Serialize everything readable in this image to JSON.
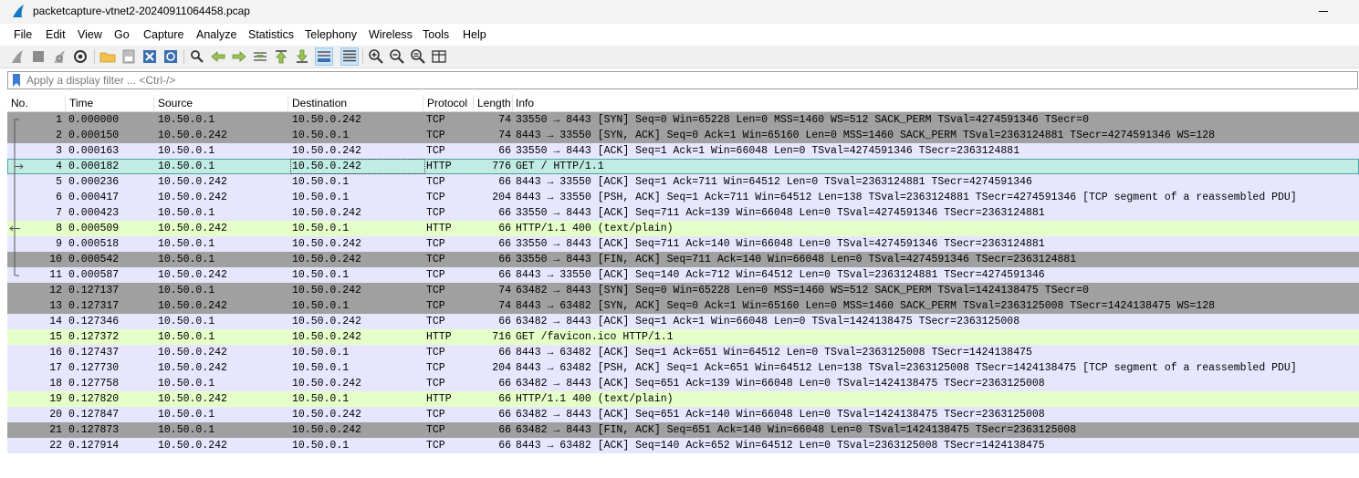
{
  "window": {
    "title": "packetcapture-vtnet2-20240911064458.pcap"
  },
  "menu": [
    "File",
    "Edit",
    "View",
    "Go",
    "Capture",
    "Analyze",
    "Statistics",
    "Telephony",
    "Wireless",
    "Tools",
    "Help"
  ],
  "toolbar": {
    "icons": [
      "shark-fin-start-icon",
      "stop-square-icon",
      "shark-fin-restart-icon",
      "capture-options-gear-icon",
      "open-folder-icon",
      "save-file-icon",
      "close-file-icon",
      "reload-file-icon",
      "find-packet-icon",
      "go-back-icon",
      "go-forward-icon",
      "go-to-packet-icon",
      "go-first-icon",
      "go-last-icon",
      "autoscroll-icon",
      "colorize-icon",
      "zoom-in-icon",
      "zoom-out-icon",
      "zoom-normal-icon",
      "resize-columns-icon"
    ]
  },
  "filter": {
    "placeholder": "Apply a display filter ... <Ctrl-/>",
    "value": ""
  },
  "columns": [
    "No.",
    "Time",
    "Source",
    "Destination",
    "Protocol",
    "Length",
    "Info"
  ],
  "packets": [
    {
      "no": "1",
      "time": "0.000000",
      "src": "10.50.0.1",
      "dst": "10.50.0.242",
      "proto": "TCP",
      "len": "74",
      "info": "33550 → 8443 [SYN] Seq=0 Win=65228 Len=0 MSS=1460 WS=512 SACK_PERM TSval=4274591346 TSecr=0",
      "color": "syn"
    },
    {
      "no": "2",
      "time": "0.000150",
      "src": "10.50.0.242",
      "dst": "10.50.0.1",
      "proto": "TCP",
      "len": "74",
      "info": "8443 → 33550 [SYN, ACK] Seq=0 Ack=1 Win=65160 Len=0 MSS=1460 SACK_PERM TSval=2363124881 TSecr=4274591346 WS=128",
      "color": "syn"
    },
    {
      "no": "3",
      "time": "0.000163",
      "src": "10.50.0.1",
      "dst": "10.50.0.242",
      "proto": "TCP",
      "len": "66",
      "info": "33550 → 8443 [ACK] Seq=1 Ack=1 Win=66048 Len=0 TSval=4274591346 TSecr=2363124881",
      "color": "tcp"
    },
    {
      "no": "4",
      "time": "0.000182",
      "src": "10.50.0.1",
      "dst": "10.50.0.242",
      "proto": "HTTP",
      "len": "776",
      "info": "GET / HTTP/1.1",
      "color": "sel"
    },
    {
      "no": "5",
      "time": "0.000236",
      "src": "10.50.0.242",
      "dst": "10.50.0.1",
      "proto": "TCP",
      "len": "66",
      "info": "8443 → 33550 [ACK] Seq=1 Ack=711 Win=64512 Len=0 TSval=2363124881 TSecr=4274591346",
      "color": "tcp"
    },
    {
      "no": "6",
      "time": "0.000417",
      "src": "10.50.0.242",
      "dst": "10.50.0.1",
      "proto": "TCP",
      "len": "204",
      "info": "8443 → 33550 [PSH, ACK] Seq=1 Ack=711 Win=64512 Len=138 TSval=2363124881 TSecr=4274591346 [TCP segment of a reassembled PDU]",
      "color": "tcp"
    },
    {
      "no": "7",
      "time": "0.000423",
      "src": "10.50.0.1",
      "dst": "10.50.0.242",
      "proto": "TCP",
      "len": "66",
      "info": "33550 → 8443 [ACK] Seq=711 Ack=139 Win=66048 Len=0 TSval=4274591346 TSecr=2363124881",
      "color": "tcp"
    },
    {
      "no": "8",
      "time": "0.000509",
      "src": "10.50.0.242",
      "dst": "10.50.0.1",
      "proto": "HTTP",
      "len": "66",
      "info": "HTTP/1.1 400   (text/plain)",
      "color": "http"
    },
    {
      "no": "9",
      "time": "0.000518",
      "src": "10.50.0.1",
      "dst": "10.50.0.242",
      "proto": "TCP",
      "len": "66",
      "info": "33550 → 8443 [ACK] Seq=711 Ack=140 Win=66048 Len=0 TSval=4274591346 TSecr=2363124881",
      "color": "tcp"
    },
    {
      "no": "10",
      "time": "0.000542",
      "src": "10.50.0.1",
      "dst": "10.50.0.242",
      "proto": "TCP",
      "len": "66",
      "info": "33550 → 8443 [FIN, ACK] Seq=711 Ack=140 Win=66048 Len=0 TSval=4274591346 TSecr=2363124881",
      "color": "syn"
    },
    {
      "no": "11",
      "time": "0.000587",
      "src": "10.50.0.242",
      "dst": "10.50.0.1",
      "proto": "TCP",
      "len": "66",
      "info": "8443 → 33550 [ACK] Seq=140 Ack=712 Win=64512 Len=0 TSval=2363124881 TSecr=4274591346",
      "color": "tcp"
    },
    {
      "no": "12",
      "time": "0.127137",
      "src": "10.50.0.1",
      "dst": "10.50.0.242",
      "proto": "TCP",
      "len": "74",
      "info": "63482 → 8443 [SYN] Seq=0 Win=65228 Len=0 MSS=1460 WS=512 SACK_PERM TSval=1424138475 TSecr=0",
      "color": "syn"
    },
    {
      "no": "13",
      "time": "0.127317",
      "src": "10.50.0.242",
      "dst": "10.50.0.1",
      "proto": "TCP",
      "len": "74",
      "info": "8443 → 63482 [SYN, ACK] Seq=0 Ack=1 Win=65160 Len=0 MSS=1460 SACK_PERM TSval=2363125008 TSecr=1424138475 WS=128",
      "color": "syn"
    },
    {
      "no": "14",
      "time": "0.127346",
      "src": "10.50.0.1",
      "dst": "10.50.0.242",
      "proto": "TCP",
      "len": "66",
      "info": "63482 → 8443 [ACK] Seq=1 Ack=1 Win=66048 Len=0 TSval=1424138475 TSecr=2363125008",
      "color": "tcp"
    },
    {
      "no": "15",
      "time": "0.127372",
      "src": "10.50.0.1",
      "dst": "10.50.0.242",
      "proto": "HTTP",
      "len": "716",
      "info": "GET /favicon.ico HTTP/1.1",
      "color": "http"
    },
    {
      "no": "16",
      "time": "0.127437",
      "src": "10.50.0.242",
      "dst": "10.50.0.1",
      "proto": "TCP",
      "len": "66",
      "info": "8443 → 63482 [ACK] Seq=1 Ack=651 Win=64512 Len=0 TSval=2363125008 TSecr=1424138475",
      "color": "tcp"
    },
    {
      "no": "17",
      "time": "0.127730",
      "src": "10.50.0.242",
      "dst": "10.50.0.1",
      "proto": "TCP",
      "len": "204",
      "info": "8443 → 63482 [PSH, ACK] Seq=1 Ack=651 Win=64512 Len=138 TSval=2363125008 TSecr=1424138475 [TCP segment of a reassembled PDU]",
      "color": "tcp"
    },
    {
      "no": "18",
      "time": "0.127758",
      "src": "10.50.0.1",
      "dst": "10.50.0.242",
      "proto": "TCP",
      "len": "66",
      "info": "63482 → 8443 [ACK] Seq=651 Ack=139 Win=66048 Len=0 TSval=1424138475 TSecr=2363125008",
      "color": "tcp"
    },
    {
      "no": "19",
      "time": "0.127820",
      "src": "10.50.0.242",
      "dst": "10.50.0.1",
      "proto": "HTTP",
      "len": "66",
      "info": "HTTP/1.1 400   (text/plain)",
      "color": "http"
    },
    {
      "no": "20",
      "time": "0.127847",
      "src": "10.50.0.1",
      "dst": "10.50.0.242",
      "proto": "TCP",
      "len": "66",
      "info": "63482 → 8443 [ACK] Seq=651 Ack=140 Win=66048 Len=0 TSval=1424138475 TSecr=2363125008",
      "color": "tcp"
    },
    {
      "no": "21",
      "time": "0.127873",
      "src": "10.50.0.1",
      "dst": "10.50.0.242",
      "proto": "TCP",
      "len": "66",
      "info": "63482 → 8443 [FIN, ACK] Seq=651 Ack=140 Win=66048 Len=0 TSval=1424138475 TSecr=2363125008",
      "color": "syn"
    },
    {
      "no": "22",
      "time": "0.127914",
      "src": "10.50.0.242",
      "dst": "10.50.0.1",
      "proto": "TCP",
      "len": "66",
      "info": "8443 → 63482 [ACK] Seq=140 Ack=652 Win=64512 Len=0 TSval=2363125008 TSecr=1424138475",
      "color": "tcp"
    }
  ]
}
